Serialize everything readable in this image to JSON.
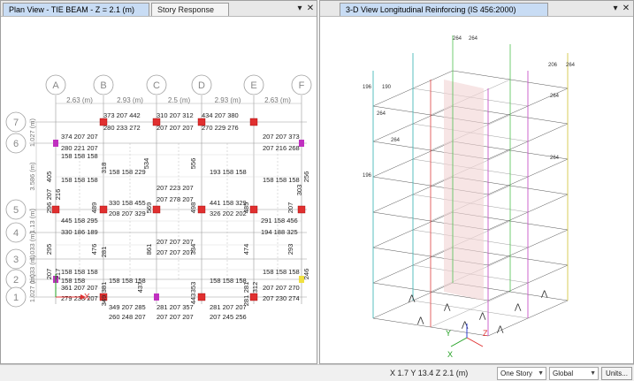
{
  "left_panel": {
    "tabs": [
      {
        "label": "Plan View - TIE BEAM - Z = 2.1 (m)",
        "active": true
      },
      {
        "label": "Story Response",
        "active": false
      }
    ],
    "controls": {
      "menu": "▾",
      "close": "✕"
    },
    "grid_columns": [
      "A",
      "B",
      "C",
      "D",
      "E",
      "F"
    ],
    "grid_rows": [
      "7",
      "6",
      "5",
      "4",
      "3",
      "2",
      "1"
    ],
    "column_spacings": [
      "2.63 (m)",
      "2.93 (m)",
      "2.5 (m)",
      "2.93 (m)",
      "2.63 (m)"
    ],
    "row_spacings": [
      "1.027 (m)",
      "3.586 (m)",
      "1.13 (m)",
      "1.033 (m)",
      "1.033 (m)",
      "1.027 (m)"
    ],
    "axis_label": "X",
    "beam_labels": [
      "373 207 442",
      "280 233 272",
      "310 207 312",
      "207 207 207",
      "434 207 380",
      "270 229 276",
      "374 207 207",
      "280 221 207",
      "158 158 158",
      "207 207 373",
      "207 216 268",
      "158 158 229",
      "193 158 158",
      "158 158 158",
      "158 158 158",
      "207 223 207",
      "207 278 207",
      "330 158 455",
      "208 207 329",
      "441 158 329",
      "326 202 202",
      "445 158 295",
      "330 186 189",
      "291 158 456",
      "194 188 325",
      "207 207 207",
      "207 207 207",
      "158 158",
      "158 158 158",
      "158 158 158",
      "158 158 158",
      "158 158 158",
      "361 207 207",
      "207 207 270",
      "279 233 207",
      "207 230 274",
      "349 207 285",
      "260 248 207",
      "281 207 357",
      "207 245 256",
      "281 207 207",
      "207 207 207"
    ],
    "column_labels": [
      "405",
      "318",
      "534",
      "556",
      "207",
      "256",
      "216",
      "296",
      "489",
      "569",
      "498",
      "485",
      "207",
      "303",
      "295",
      "476",
      "861",
      "334",
      "474",
      "293",
      "207",
      "217",
      "281",
      "381",
      "353",
      "281",
      "246",
      "437",
      "443",
      "312",
      "349",
      "281"
    ]
  },
  "right_panel": {
    "tab": {
      "label": "3-D View  Longitudinal Reinforcing  (IS 456:2000)",
      "active": true
    },
    "controls": {
      "menu": "▾",
      "close": "✕"
    },
    "axis_labels": [
      "Y",
      "X",
      "Z"
    ],
    "top_labels": [
      "264",
      "264",
      "196",
      "190",
      "206",
      "264",
      "264",
      "264",
      "264",
      "196",
      "264"
    ]
  },
  "status_bar": {
    "coordinates": "X 1.7  Y 13.4  Z 2.1 (m)",
    "story_select": "One Story",
    "system_select": "Global",
    "units_button": "Units..."
  },
  "colors": {
    "tab_active": "#c8dcf4",
    "grid_bubble": "#a0a0a0",
    "beam_line": "#9a9a9a",
    "column_red": "#e03030",
    "column_magenta": "#c030c0",
    "axis_red": "#e03030",
    "axis_green": "#20a020",
    "axis_blue": "#3040d0"
  }
}
